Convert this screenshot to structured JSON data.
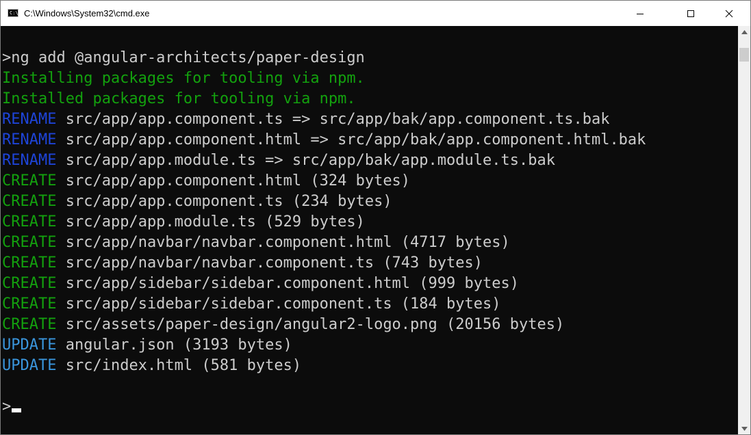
{
  "window": {
    "title": "C:\\Windows\\System32\\cmd.exe",
    "icon_label": "C:\\",
    "icon": "cmd-icon",
    "minimize_icon": "minimize-icon",
    "maximize_icon": "maximize-icon",
    "close_icon": "close-icon"
  },
  "console": {
    "command": ">ng add @angular-architects/paper-design",
    "messages": [
      "Installing packages for tooling via npm.",
      "Installed packages for tooling via npm."
    ],
    "operations": [
      {
        "action": "RENAME",
        "detail": "src/app/app.component.ts => src/app/bak/app.component.ts.bak"
      },
      {
        "action": "RENAME",
        "detail": "src/app/app.component.html => src/app/bak/app.component.html.bak"
      },
      {
        "action": "RENAME",
        "detail": "src/app/app.module.ts => src/app/bak/app.module.ts.bak"
      },
      {
        "action": "CREATE",
        "detail": "src/app/app.component.html (324 bytes)"
      },
      {
        "action": "CREATE",
        "detail": "src/app/app.component.ts (234 bytes)"
      },
      {
        "action": "CREATE",
        "detail": "src/app/app.module.ts (529 bytes)"
      },
      {
        "action": "CREATE",
        "detail": "src/app/navbar/navbar.component.html (4717 bytes)"
      },
      {
        "action": "CREATE",
        "detail": "src/app/navbar/navbar.component.ts (743 bytes)"
      },
      {
        "action": "CREATE",
        "detail": "src/app/sidebar/sidebar.component.html (999 bytes)"
      },
      {
        "action": "CREATE",
        "detail": "src/app/sidebar/sidebar.component.ts (184 bytes)"
      },
      {
        "action": "CREATE",
        "detail": "src/assets/paper-design/angular2-logo.png (20156 bytes)"
      },
      {
        "action": "UPDATE",
        "detail": "angular.json (3193 bytes)"
      },
      {
        "action": "UPDATE",
        "detail": "src/index.html (581 bytes)"
      }
    ],
    "prompt": ">"
  },
  "colors": {
    "background": "#0c0c0c",
    "default_text": "#cccccc",
    "green": "#13a10e",
    "rename_blue": "#1e44d8",
    "update_cyan": "#3a96dd"
  },
  "scrollbar": {
    "up_icon": "scroll-up-arrow-icon",
    "down_icon": "scroll-down-arrow-icon"
  }
}
